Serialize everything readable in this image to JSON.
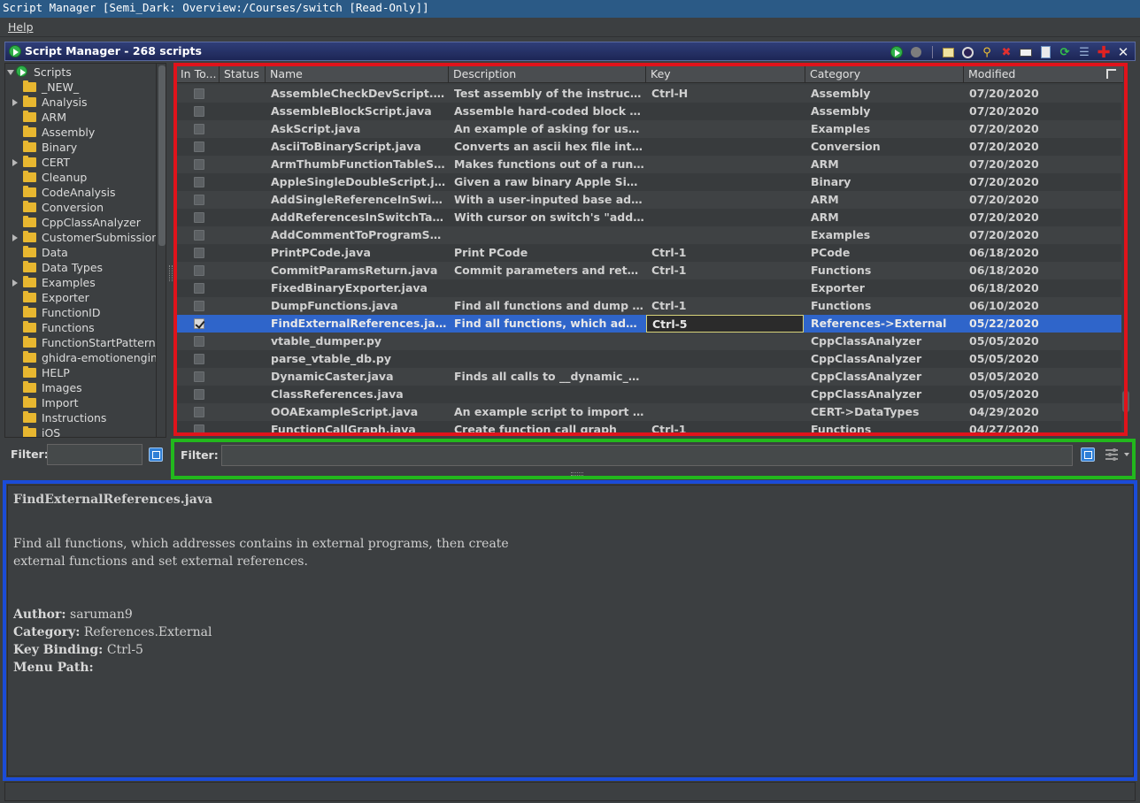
{
  "window": {
    "title": "Script Manager [Semi_Dark: Overview:/Courses/switch [Read-Only]]"
  },
  "menu": {
    "help": "Help"
  },
  "panel": {
    "title": "Script Manager - 268 scripts"
  },
  "toolbar": {
    "run": "run-script-icon",
    "run_last": "run-last-script-icon",
    "edit": "edit-script-icon",
    "eclipse": "edit-with-eclipse-icon",
    "key": "assign-key-binding-icon",
    "delete": "delete-script-icon",
    "rename": "rename-script-icon",
    "new": "create-new-script-icon",
    "refresh": "refresh-icon",
    "dirs": "script-directories-icon",
    "help": "help-icon",
    "close": "close-icon"
  },
  "tree": {
    "root": "Scripts",
    "items": [
      {
        "label": "_NEW_",
        "expandable": false
      },
      {
        "label": "Analysis",
        "expandable": true
      },
      {
        "label": "ARM",
        "expandable": false
      },
      {
        "label": "Assembly",
        "expandable": false
      },
      {
        "label": "Binary",
        "expandable": false
      },
      {
        "label": "CERT",
        "expandable": true
      },
      {
        "label": "Cleanup",
        "expandable": false
      },
      {
        "label": "CodeAnalysis",
        "expandable": false
      },
      {
        "label": "Conversion",
        "expandable": false
      },
      {
        "label": "CppClassAnalyzer",
        "expandable": false
      },
      {
        "label": "CustomerSubmission",
        "expandable": true
      },
      {
        "label": "Data",
        "expandable": false
      },
      {
        "label": "Data Types",
        "expandable": false
      },
      {
        "label": "Examples",
        "expandable": true
      },
      {
        "label": "Exporter",
        "expandable": false
      },
      {
        "label": "FunctionID",
        "expandable": false
      },
      {
        "label": "Functions",
        "expandable": false
      },
      {
        "label": "FunctionStartPatterns",
        "expandable": false
      },
      {
        "label": "ghidra-emotionengine",
        "expandable": false
      },
      {
        "label": "HELP",
        "expandable": false
      },
      {
        "label": "Images",
        "expandable": false
      },
      {
        "label": "Import",
        "expandable": false
      },
      {
        "label": "Instructions",
        "expandable": false
      },
      {
        "label": "iOS",
        "expandable": false
      }
    ]
  },
  "left_filter": {
    "label": "Filter:",
    "value": ""
  },
  "table": {
    "columns": [
      "In To...",
      "Status",
      "Name",
      "Description",
      "Key",
      "Category",
      "Modified"
    ],
    "rows": [
      {
        "checked": false,
        "status": "",
        "name": "AssembleCheckDevScript.java",
        "desc": "Test assembly of the instruction u...",
        "key": "Ctrl-H",
        "category": "Assembly",
        "modified": "07/20/2020"
      },
      {
        "checked": false,
        "status": "",
        "name": "AssembleBlockScript.java",
        "desc": "Assemble hard-coded block of ins...",
        "key": "",
        "category": "Assembly",
        "modified": "07/20/2020"
      },
      {
        "checked": false,
        "status": "",
        "name": "AskScript.java",
        "desc": "An example of asking for user inp...",
        "key": "",
        "category": "Examples",
        "modified": "07/20/2020"
      },
      {
        "checked": false,
        "status": "",
        "name": "AsciiToBinaryScript.java",
        "desc": "Converts an ascii hex file into bin...",
        "key": "",
        "category": "Conversion",
        "modified": "07/20/2020"
      },
      {
        "checked": false,
        "status": "",
        "name": "ArmThumbFunctionTableScrip...",
        "desc": "Makes functions out of a run of se...",
        "key": "",
        "category": "ARM",
        "modified": "07/20/2020"
      },
      {
        "checked": false,
        "status": "",
        "name": "AppleSingleDoubleScript.java",
        "desc": "Given a raw binary Apple Single/...",
        "key": "",
        "category": "Binary",
        "modified": "07/20/2020"
      },
      {
        "checked": false,
        "status": "",
        "name": "AddSingleReferenceInSwitchT...",
        "desc": "With a user-inputed base address...",
        "key": "",
        "category": "ARM",
        "modified": "07/20/2020"
      },
      {
        "checked": false,
        "status": "",
        "name": "AddReferencesInSwitchTable.j...",
        "desc": "With cursor on switch's \"add pc, ....",
        "key": "",
        "category": "ARM",
        "modified": "07/20/2020"
      },
      {
        "checked": false,
        "status": "",
        "name": "AddCommentToProgramScript....",
        "desc": "",
        "key": "",
        "category": "Examples",
        "modified": "07/20/2020"
      },
      {
        "checked": false,
        "status": "",
        "name": "PrintPCode.java",
        "desc": "Print PCode",
        "key": "Ctrl-1",
        "category": "PCode",
        "modified": "06/18/2020"
      },
      {
        "checked": false,
        "status": "",
        "name": "CommitParamsReturn.java",
        "desc": "Commit parameters and return ty...",
        "key": "Ctrl-1",
        "category": "Functions",
        "modified": "06/18/2020"
      },
      {
        "checked": false,
        "status": "",
        "name": "FixedBinaryExporter.java",
        "desc": "",
        "key": "",
        "category": "Exporter",
        "modified": "06/18/2020"
      },
      {
        "checked": false,
        "status": "",
        "name": "DumpFunctions.java",
        "desc": "Find all functions and dump addr...",
        "key": "Ctrl-1",
        "category": "Functions",
        "modified": "06/10/2020"
      },
      {
        "checked": true,
        "selected": true,
        "status": "",
        "name": "FindExternalReferences.java",
        "desc": "Find all functions, which address...",
        "key": "Ctrl-5",
        "category": "References->External",
        "modified": "05/22/2020"
      },
      {
        "checked": false,
        "status": "",
        "name": "vtable_dumper.py",
        "desc": "",
        "key": "",
        "category": "CppClassAnalyzer",
        "modified": "05/05/2020"
      },
      {
        "checked": false,
        "status": "",
        "name": "parse_vtable_db.py",
        "desc": "",
        "key": "",
        "category": "CppClassAnalyzer",
        "modified": "05/05/2020"
      },
      {
        "checked": false,
        "status": "",
        "name": "DynamicCaster.java",
        "desc": "Finds all calls to __dynamic_cast, ...",
        "key": "",
        "category": "CppClassAnalyzer",
        "modified": "05/05/2020"
      },
      {
        "checked": false,
        "status": "",
        "name": "ClassReferences.java",
        "desc": "",
        "key": "",
        "category": "CppClassAnalyzer",
        "modified": "05/05/2020"
      },
      {
        "checked": false,
        "status": "",
        "name": "OOAExampleScript.java",
        "desc": "An example script to import Phar...",
        "key": "",
        "category": "CERT->DataTypes",
        "modified": "04/29/2020"
      },
      {
        "checked": false,
        "status": "",
        "name": "FunctionCallGraph.java",
        "desc": "Create function call graph",
        "key": "Ctrl-1",
        "category": "Functions",
        "modified": "04/27/2020"
      }
    ]
  },
  "right_filter": {
    "label": "Filter:",
    "value": ""
  },
  "details": {
    "title": "FindExternalReferences.java",
    "desc_line1": "Find all functions, which addresses contains in external programs, then create",
    "desc_line2": "external functions and set external references.",
    "author_label": "Author:",
    "author": "saruman9",
    "category_label": "Category:",
    "category": "References.External",
    "keybinding_label": "Key Binding:",
    "keybinding": "Ctrl-5",
    "menupath_label": "Menu Path:",
    "menupath": ""
  },
  "colors": {
    "highlight_table": "#e0131b",
    "highlight_filter": "#22b81d",
    "highlight_details": "#1b4cd8",
    "selection": "#2f65ca"
  }
}
